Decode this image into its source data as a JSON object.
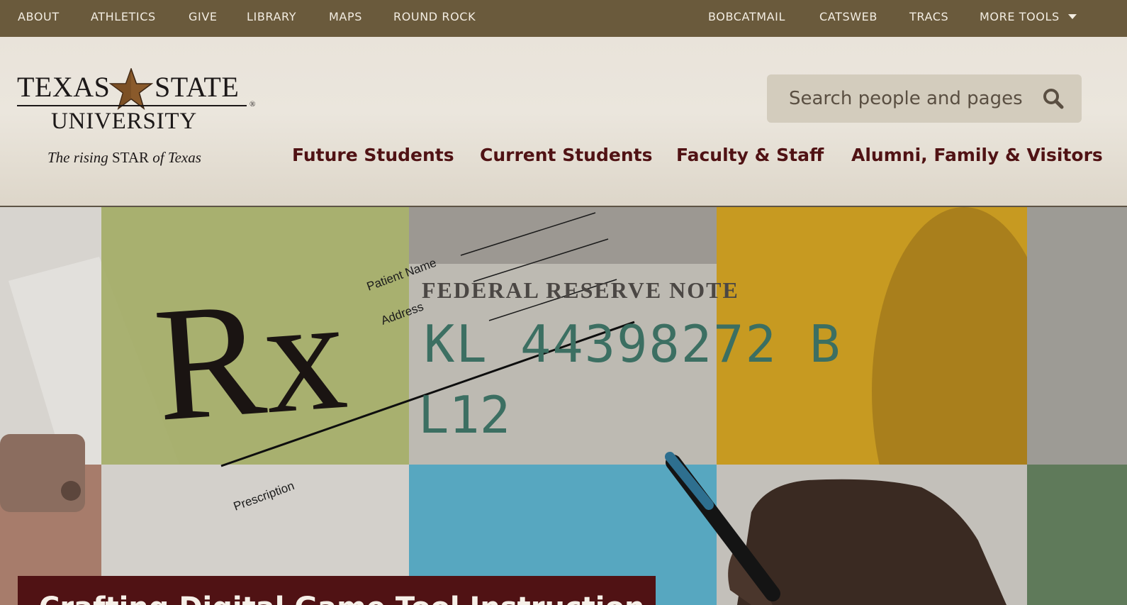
{
  "topbar": {
    "left_links": [
      "ABOUT",
      "ATHLETICS",
      "GIVE",
      "LIBRARY",
      "MAPS",
      "ROUND ROCK"
    ],
    "right_links": [
      "BOBCATMAIL",
      "CATSWEB",
      "TRACS"
    ],
    "more_tools_label": "MORE TOOLS"
  },
  "logo": {
    "wordmark_left": "TEXAS",
    "wordmark_right": "STATE",
    "wordmark_line2": "UNIVERSITY",
    "registered": "®",
    "tagline_prefix": "The rising",
    "tagline_star": "STAR",
    "tagline_of": "of",
    "tagline_texas": "Texas"
  },
  "search": {
    "placeholder": "Search people and pages",
    "icon": "search-icon"
  },
  "main_nav": [
    "Future Students",
    "Current Students",
    "Faculty & Staff",
    "Alumni, Family & Visitors"
  ],
  "hero": {
    "image_text": {
      "rx": "Rx",
      "patient_name": "Patient Name",
      "address": "Address",
      "prescription": "Prescription",
      "federal_reserve_note": "FEDERAL RESERVE NOTE",
      "serial": "KL 44398272 B",
      "plate": "L12"
    },
    "headline": "Crafting Digital Game Tool Instruction"
  },
  "colors": {
    "topbar": "#6a5a3c",
    "maroon": "#501214",
    "header_bg": "#e9e3da",
    "search_bg": "#d3ccbd",
    "gold": "#8a5a2b"
  }
}
